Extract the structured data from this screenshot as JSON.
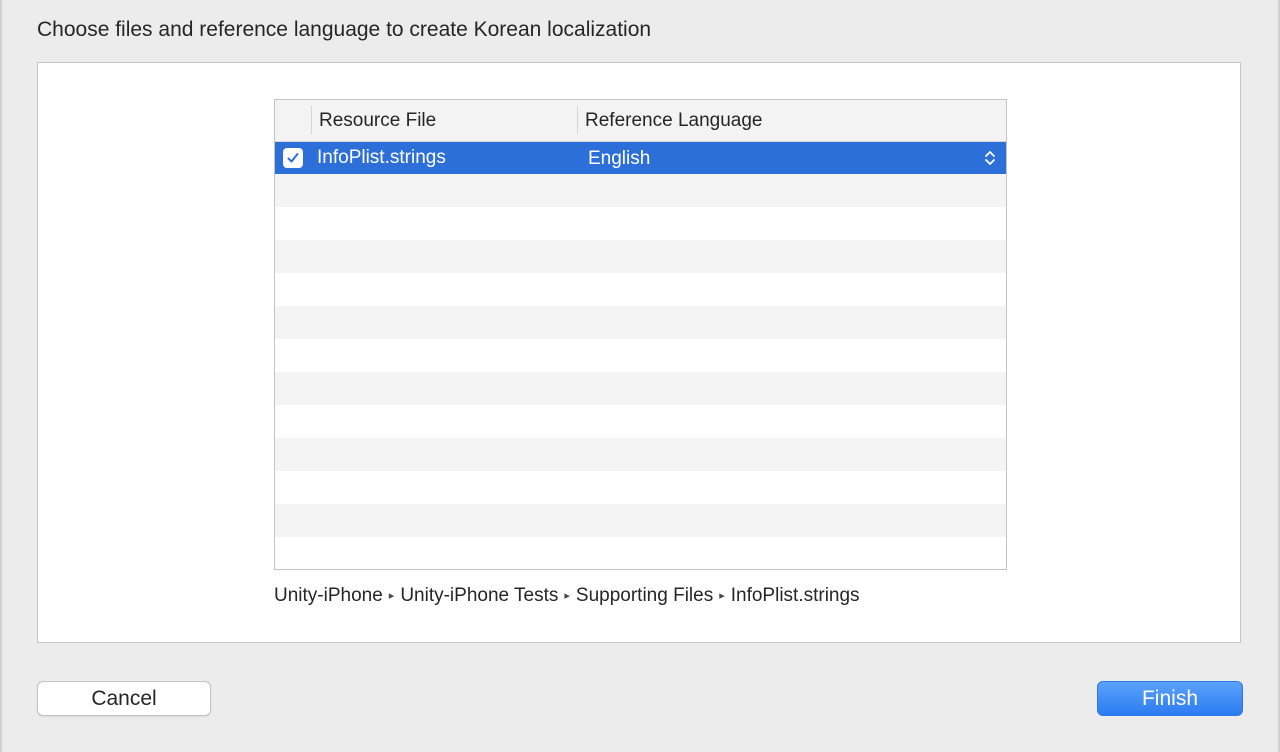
{
  "dialog": {
    "prompt": "Choose files and reference language to create Korean localization"
  },
  "table": {
    "columns": [
      "Resource File",
      "Reference Language"
    ],
    "rows": [
      {
        "checked": true,
        "file": "InfoPlist.strings",
        "language": "English",
        "selected": true
      }
    ]
  },
  "path": {
    "items": [
      "Unity-iPhone",
      "Unity-iPhone Tests",
      "Supporting Files",
      "InfoPlist.strings"
    ],
    "separator": "▸"
  },
  "buttons": {
    "cancel": "Cancel",
    "finish": "Finish"
  },
  "icons": {
    "checkbox": "checkmark-icon",
    "popup": "up-down-chevron-icon"
  },
  "colors": {
    "selection": "#2d6fd8",
    "accent": "#2c7bf2"
  }
}
